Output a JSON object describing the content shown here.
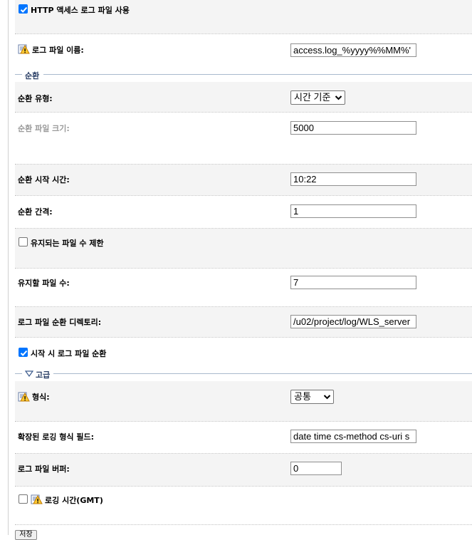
{
  "http_access_log": {
    "label": "HTTP 액세스 로그 파일 사용",
    "checked": true
  },
  "log_file_name": {
    "label": "로그 파일 이름:",
    "value": "access.log_%yyyy%%MM%'"
  },
  "rotation_section": {
    "title": "순환"
  },
  "rotation_type": {
    "label": "순환 유형:",
    "selected": "시간 기준"
  },
  "rotation_file_size": {
    "label": "순환 파일 크기:",
    "value": "5000"
  },
  "rotation_start_time": {
    "label": "순환 시작 시간:",
    "value": "10:22"
  },
  "rotation_interval": {
    "label": "순환 간격:",
    "value": "1"
  },
  "limit_retained_files": {
    "label": "유지되는 파일 수 제한",
    "checked": false
  },
  "files_to_retain": {
    "label": "유지할 파일 수:",
    "value": "7"
  },
  "rotation_directory": {
    "label": "로그 파일 순환 디렉토리:",
    "value": "/u02/project/log/WLS_server"
  },
  "rotate_on_startup": {
    "label": "시작 시 로그 파일 순환",
    "checked": true
  },
  "advanced_section": {
    "title": "고급"
  },
  "format": {
    "label": "형식:",
    "selected": "공통"
  },
  "extended_fields": {
    "label": "확장된 로깅 형식 필드:",
    "value": "date time cs-method cs-uri s"
  },
  "log_buffer": {
    "label": "로그 파일 버퍼:",
    "value": "0"
  },
  "logging_time_gmt": {
    "label": "로깅 시간(GMT)",
    "checked": false
  },
  "save_button": {
    "label": "저장"
  }
}
